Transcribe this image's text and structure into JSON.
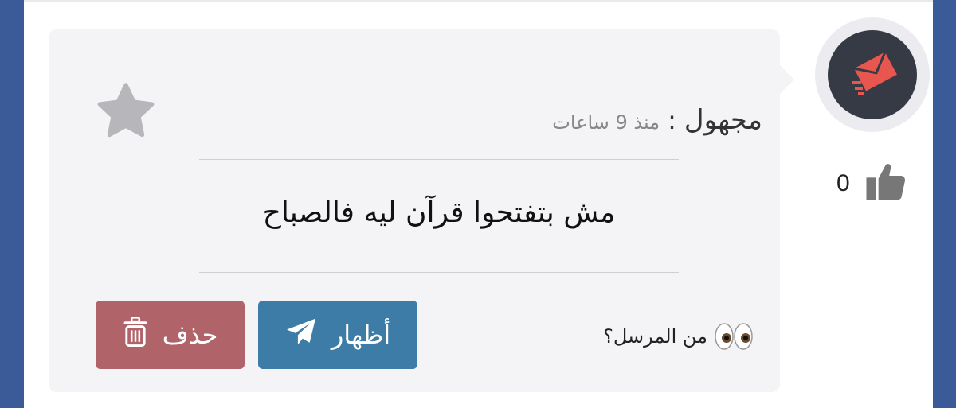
{
  "message": {
    "sender": "مجهول",
    "separator": ":",
    "time": "منذ 9 ساعات",
    "text": "مش بتفتحوا قرآن ليه فالصباح"
  },
  "actions": {
    "show_label": "أظهار",
    "delete_label": "حذف",
    "who_sent_label": "من المرسل؟"
  },
  "likes": {
    "count": "0"
  },
  "colors": {
    "background": "#3a5b97",
    "card": "#f4f4f7",
    "show_button": "#3d7ca6",
    "delete_button": "#b0646a",
    "avatar_bg": "#353a44",
    "logo": "#e8574f"
  },
  "icons": [
    "star-icon",
    "envelope-logo-icon",
    "thumbs-up-icon",
    "paper-plane-icon",
    "trash-icon",
    "eyes-icon"
  ]
}
